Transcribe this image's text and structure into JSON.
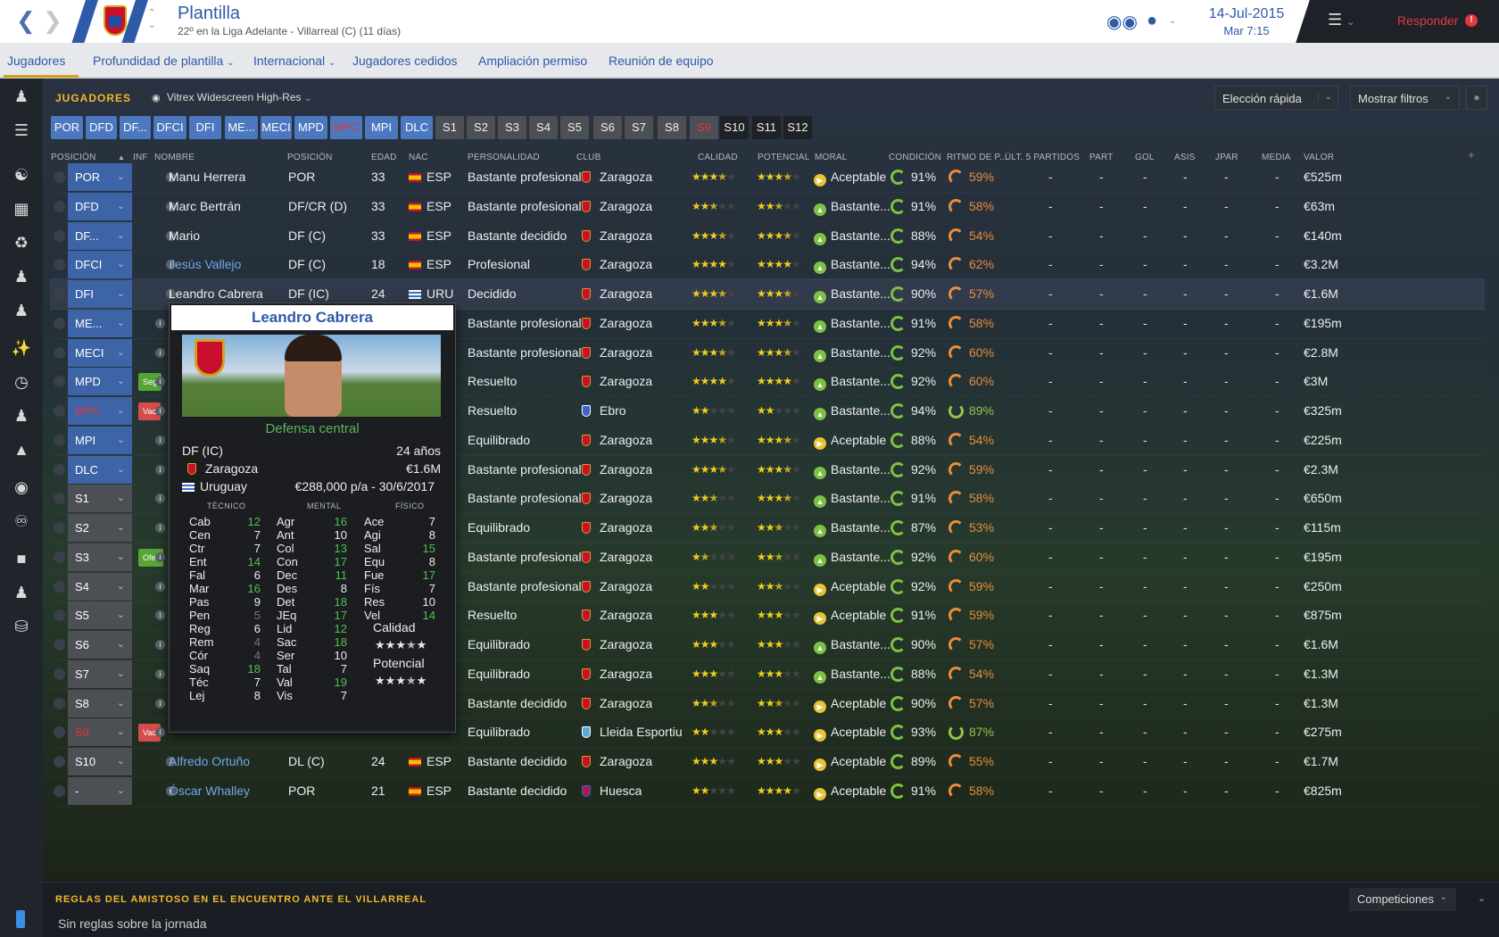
{
  "header": {
    "title": "Plantilla",
    "subtitle": "22º en la Liga Adelante - Villarreal (C) (11 días)",
    "date": "14-Jul-2015",
    "time": "Mar 7:15",
    "respond_label": "Responder",
    "respond_badge": "!"
  },
  "tabs": [
    "Jugadores",
    "Profundidad de plantilla",
    "Internacional",
    "Jugadores cedidos",
    "Ampliación permiso",
    "Reunión de equipo"
  ],
  "panel": {
    "label": "JUGADORES",
    "view_name": "Vitrex Widescreen High-Res",
    "quick_pick": "Elección rápida",
    "show_filters": "Mostrar filtros"
  },
  "position_chips": [
    "POR",
    "DFD",
    "DF...",
    "DFCI",
    "DFI",
    "ME...",
    "MECI",
    "MPD",
    "MPC",
    "MPI",
    "DLC",
    "S1",
    "S2",
    "S3",
    "S4",
    "S5",
    "S6",
    "S7",
    "S8",
    "S9",
    "S10",
    "S11",
    "S12"
  ],
  "columns": [
    "POSICIÓN",
    "INF",
    "NOMBRE",
    "POSICIÓN",
    "EDAD",
    "NAC",
    "PERSONALIDAD",
    "CLUB",
    "CALIDAD",
    "POTENCIAL",
    "MORAL",
    "CONDICIÓN",
    "RITMO DE P...",
    "ÚLT. 5 PARTIDOS",
    "PART",
    "GOL",
    "ASIS",
    "JPAR",
    "MEDIA",
    "VALOR"
  ],
  "players": [
    {
      "slot": "POR",
      "tag": "",
      "name": "Manu Herrera",
      "pos": "POR",
      "age": "33",
      "nat": "ESP",
      "pers": "Bastante profesional",
      "club": "Zaragoza",
      "q": 3.5,
      "p": 3.5,
      "moral": "Aceptable",
      "cond": "91%",
      "ritmo": "59%",
      "l5": "-",
      "part": "-",
      "gol": "-",
      "asis": "-",
      "jpar": "-",
      "media": "-",
      "value": "€525m"
    },
    {
      "slot": "DFD",
      "tag": "",
      "name": "Marc Bertrán",
      "pos": "DF/CR (D)",
      "age": "33",
      "nat": "ESP",
      "pers": "Bastante profesional",
      "club": "Zaragoza",
      "q": 2.5,
      "p": 2.5,
      "moral": "Bastante...",
      "cond": "91%",
      "ritmo": "58%",
      "l5": "-",
      "part": "-",
      "gol": "-",
      "asis": "-",
      "jpar": "-",
      "media": "-",
      "value": "€63m"
    },
    {
      "slot": "DF...",
      "tag": "",
      "name": "Mario",
      "pos": "DF (C)",
      "age": "33",
      "nat": "ESP",
      "pers": "Bastante decidido",
      "club": "Zaragoza",
      "q": 3.5,
      "p": 3.5,
      "moral": "Bastante...",
      "cond": "88%",
      "ritmo": "54%",
      "l5": "-",
      "part": "-",
      "gol": "-",
      "asis": "-",
      "jpar": "-",
      "media": "-",
      "value": "€140m"
    },
    {
      "slot": "DFCI",
      "tag": "",
      "name": "Jesús Vallejo",
      "pos": "DF (C)",
      "age": "18",
      "nat": "ESP",
      "pers": "Profesional",
      "club": "Zaragoza",
      "q": 4,
      "p": 4,
      "moral": "Bastante...",
      "cond": "94%",
      "ritmo": "62%",
      "l5": "-",
      "part": "-",
      "gol": "-",
      "asis": "-",
      "jpar": "-",
      "media": "-",
      "value": "€3.2M"
    },
    {
      "slot": "DFI",
      "tag": "",
      "name": "Leandro Cabrera",
      "pos": "DF (IC)",
      "age": "24",
      "nat": "URU",
      "pers": "Decidido",
      "club": "Zaragoza",
      "q": 3.5,
      "p": 3.5,
      "moral": "Bastante...",
      "cond": "90%",
      "ritmo": "57%",
      "l5": "-",
      "part": "-",
      "gol": "-",
      "asis": "-",
      "jpar": "-",
      "media": "-",
      "value": "€1.6M"
    },
    {
      "slot": "ME...",
      "tag": "",
      "name": "",
      "pos": "",
      "age": "",
      "nat": "",
      "pers": "Bastante profesional",
      "club": "Zaragoza",
      "q": 3.5,
      "p": 3.5,
      "moral": "Bastante...",
      "cond": "91%",
      "ritmo": "58%",
      "l5": "-",
      "part": "-",
      "gol": "-",
      "asis": "-",
      "jpar": "-",
      "media": "-",
      "value": "€195m"
    },
    {
      "slot": "MECI",
      "tag": "",
      "name": "",
      "pos": "",
      "age": "",
      "nat": "",
      "pers": "Bastante profesional",
      "club": "Zaragoza",
      "q": 3.5,
      "p": 3.5,
      "moral": "Bastante...",
      "cond": "92%",
      "ritmo": "60%",
      "l5": "-",
      "part": "-",
      "gol": "-",
      "asis": "-",
      "jpar": "-",
      "media": "-",
      "value": "€2.8M"
    },
    {
      "slot": "MPD",
      "tag": "Seg",
      "name": "",
      "pos": "",
      "age": "",
      "nat": "",
      "pers": "Resuelto",
      "club": "Zaragoza",
      "q": 4,
      "p": 4,
      "moral": "Bastante...",
      "cond": "92%",
      "ritmo": "60%",
      "l5": "-",
      "part": "-",
      "gol": "-",
      "asis": "-",
      "jpar": "-",
      "media": "-",
      "value": "€3M"
    },
    {
      "slot": "MPC",
      "tag": "Vac",
      "name": "",
      "pos": "",
      "age": "",
      "nat": "",
      "pers": "Resuelto",
      "club": "Ebro",
      "q": 2,
      "p": 2,
      "moral": "Bastante...",
      "cond": "94%",
      "ritmo": "89%",
      "l5": "-",
      "part": "-",
      "gol": "-",
      "asis": "-",
      "jpar": "-",
      "media": "-",
      "value": "€325m"
    },
    {
      "slot": "MPI",
      "tag": "",
      "name": "",
      "pos": "",
      "age": "",
      "nat": "",
      "pers": "Equilibrado",
      "club": "Zaragoza",
      "q": 3.5,
      "p": 3.5,
      "moral": "Aceptable",
      "cond": "88%",
      "ritmo": "54%",
      "l5": "-",
      "part": "-",
      "gol": "-",
      "asis": "-",
      "jpar": "-",
      "media": "-",
      "value": "€225m"
    },
    {
      "slot": "DLC",
      "tag": "",
      "name": "",
      "pos": "",
      "age": "",
      "nat": "",
      "pers": "Bastante profesional",
      "club": "Zaragoza",
      "q": 3.5,
      "p": 3.5,
      "moral": "Bastante...",
      "cond": "92%",
      "ritmo": "59%",
      "l5": "-",
      "part": "-",
      "gol": "-",
      "asis": "-",
      "jpar": "-",
      "media": "-",
      "value": "€2.3M"
    },
    {
      "slot": "S1",
      "tag": "",
      "name": "",
      "pos": "",
      "age": "",
      "nat": "",
      "pers": "Bastante profesional",
      "club": "Zaragoza",
      "q": 2.5,
      "p": 3.5,
      "moral": "Bastante...",
      "cond": "91%",
      "ritmo": "58%",
      "l5": "-",
      "part": "-",
      "gol": "-",
      "asis": "-",
      "jpar": "-",
      "media": "-",
      "value": "€650m"
    },
    {
      "slot": "S2",
      "tag": "",
      "name": "",
      "pos": "",
      "age": "",
      "nat": "",
      "pers": "Equilibrado",
      "club": "Zaragoza",
      "q": 2.5,
      "p": 2.5,
      "moral": "Bastante...",
      "cond": "87%",
      "ritmo": "53%",
      "l5": "-",
      "part": "-",
      "gol": "-",
      "asis": "-",
      "jpar": "-",
      "media": "-",
      "value": "€115m"
    },
    {
      "slot": "S3",
      "tag": "Ofer",
      "name": "",
      "pos": "",
      "age": "",
      "nat": "",
      "pers": "Bastante profesional",
      "club": "Zaragoza",
      "q": 1.5,
      "p": 2.5,
      "moral": "Bastante...",
      "cond": "92%",
      "ritmo": "60%",
      "l5": "-",
      "part": "-",
      "gol": "-",
      "asis": "-",
      "jpar": "-",
      "media": "-",
      "value": "€195m"
    },
    {
      "slot": "S4",
      "tag": "",
      "name": "",
      "pos": "",
      "age": "",
      "nat": "",
      "pers": "Bastante profesional",
      "club": "Zaragoza",
      "q": 2,
      "p": 2.5,
      "moral": "Aceptable",
      "cond": "92%",
      "ritmo": "59%",
      "l5": "-",
      "part": "-",
      "gol": "-",
      "asis": "-",
      "jpar": "-",
      "media": "-",
      "value": "€250m"
    },
    {
      "slot": "S5",
      "tag": "",
      "name": "",
      "pos": "",
      "age": "",
      "nat": "",
      "pers": "Resuelto",
      "club": "Zaragoza",
      "q": 3,
      "p": 3,
      "moral": "Aceptable",
      "cond": "91%",
      "ritmo": "59%",
      "l5": "-",
      "part": "-",
      "gol": "-",
      "asis": "-",
      "jpar": "-",
      "media": "-",
      "value": "€875m"
    },
    {
      "slot": "S6",
      "tag": "",
      "name": "",
      "pos": "",
      "age": "",
      "nat": "",
      "pers": "Equilibrado",
      "club": "Zaragoza",
      "q": 3,
      "p": 3,
      "moral": "Bastante...",
      "cond": "90%",
      "ritmo": "57%",
      "l5": "-",
      "part": "-",
      "gol": "-",
      "asis": "-",
      "jpar": "-",
      "media": "-",
      "value": "€1.6M"
    },
    {
      "slot": "S7",
      "tag": "",
      "name": "",
      "pos": "",
      "age": "",
      "nat": "",
      "pers": "Equilibrado",
      "club": "Zaragoza",
      "q": 3,
      "p": 3,
      "moral": "Bastante...",
      "cond": "88%",
      "ritmo": "54%",
      "l5": "-",
      "part": "-",
      "gol": "-",
      "asis": "-",
      "jpar": "-",
      "media": "-",
      "value": "€1.3M"
    },
    {
      "slot": "S8",
      "tag": "",
      "name": "",
      "pos": "",
      "age": "",
      "nat": "",
      "pers": "Bastante decidido",
      "club": "Zaragoza",
      "q": 2.5,
      "p": 2.5,
      "moral": "Aceptable",
      "cond": "90%",
      "ritmo": "57%",
      "l5": "-",
      "part": "-",
      "gol": "-",
      "asis": "-",
      "jpar": "-",
      "media": "-",
      "value": "€1.3M"
    },
    {
      "slot": "S9",
      "tag": "Vac",
      "name": "",
      "pos": "",
      "age": "",
      "nat": "",
      "pers": "Equilibrado",
      "club": "Lleida Esportiu",
      "q": 2,
      "p": 3,
      "moral": "Aceptable",
      "cond": "93%",
      "ritmo": "87%",
      "l5": "-",
      "part": "-",
      "gol": "-",
      "asis": "-",
      "jpar": "-",
      "media": "-",
      "value": "€275m"
    },
    {
      "slot": "S10",
      "tag": "",
      "name": "Alfredo Ortuño",
      "pos": "DL (C)",
      "age": "24",
      "nat": "ESP",
      "pers": "Bastante decidido",
      "club": "Zaragoza",
      "q": 3,
      "p": 3,
      "moral": "Aceptable",
      "cond": "89%",
      "ritmo": "55%",
      "l5": "-",
      "part": "-",
      "gol": "-",
      "asis": "-",
      "jpar": "-",
      "media": "-",
      "value": "€1.7M"
    },
    {
      "slot": "-",
      "tag": "",
      "name": "Óscar Whalley",
      "pos": "POR",
      "age": "21",
      "nat": "ESP",
      "pers": "Bastante decidido",
      "club": "Huesca",
      "q": 2,
      "p": 4,
      "moral": "Aceptable",
      "cond": "91%",
      "ritmo": "58%",
      "l5": "-",
      "part": "-",
      "gol": "-",
      "asis": "-",
      "jpar": "-",
      "media": "-",
      "value": "€825m"
    }
  ],
  "tooltip": {
    "name": "Leandro Cabrera",
    "role": "Defensa central",
    "position": "DF (IC)",
    "age": "24 años",
    "club": "Zaragoza",
    "value": "€1.6M",
    "nationality": "Uruguay",
    "contract": "€288,000 p/a  - 30/6/2017",
    "tech_label": "TÉCNICO",
    "mental_label": "MENTAL",
    "physical_label": "FÍSICO",
    "technical": [
      [
        "Cab",
        "12"
      ],
      [
        "Cen",
        "7"
      ],
      [
        "Ctr",
        "7"
      ],
      [
        "Ent",
        "14"
      ],
      [
        "Fal",
        "6"
      ],
      [
        "Mar",
        "16"
      ],
      [
        "Pas",
        "9"
      ],
      [
        "Pen",
        "5"
      ],
      [
        "Reg",
        "6"
      ],
      [
        "Rem",
        "4"
      ],
      [
        "Cór",
        "4"
      ],
      [
        "Saq",
        "18"
      ],
      [
        "Téc",
        "7"
      ],
      [
        "Lej",
        "8"
      ]
    ],
    "mental": [
      [
        "Agr",
        "16"
      ],
      [
        "Ant",
        "10"
      ],
      [
        "Col",
        "13"
      ],
      [
        "Con",
        "17"
      ],
      [
        "Dec",
        "11"
      ],
      [
        "Des",
        "8"
      ],
      [
        "Det",
        "18"
      ],
      [
        "JEq",
        "17"
      ],
      [
        "Lid",
        "12"
      ],
      [
        "Sac",
        "18"
      ],
      [
        "Ser",
        "10"
      ],
      [
        "Tal",
        "7"
      ],
      [
        "Val",
        "19"
      ],
      [
        "Vis",
        "7"
      ]
    ],
    "physical": [
      [
        "Ace",
        "7"
      ],
      [
        "Agi",
        "8"
      ],
      [
        "Sal",
        "15"
      ],
      [
        "Equ",
        "8"
      ],
      [
        "Fue",
        "17"
      ],
      [
        "Fís",
        "7"
      ],
      [
        "Res",
        "10"
      ],
      [
        "Vel",
        "14"
      ]
    ],
    "quality_label": "Calidad",
    "potential_label": "Potencial",
    "quality": 3.5,
    "potential": 3.5
  },
  "footer": {
    "title": "REGLAS DEL AMISTOSO EN EL ENCUENTRO ANTE EL VILLARREAL",
    "text": "Sin reglas sobre la jornada",
    "competitions": "Competiciones"
  },
  "colors": {
    "accent": "#2f5aa8",
    "gold": "#f2b826",
    "red": "#e3363f",
    "green": "#4cc44c"
  }
}
